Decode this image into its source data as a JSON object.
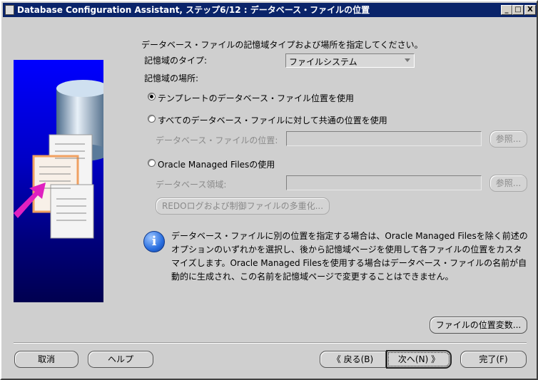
{
  "window": {
    "title": "Database Configuration Assistant, ステップ6/12 : データベース・ファイルの位置",
    "minimize": "_",
    "maximize": "□",
    "close": "X"
  },
  "instruction": "データベース・ファイルの記憶域タイプおよび場所を指定してください。",
  "storage_type": {
    "label": "記憶域のタイプ:",
    "value": "ファイルシステム"
  },
  "storage_location": {
    "label": "記憶域の場所:"
  },
  "options": [
    {
      "label": "テンプレートのデータベース・ファイル位置を使用",
      "selected": true
    },
    {
      "label": "すべてのデータベース・ファイルに対して共通の位置を使用",
      "selected": false
    },
    {
      "label": "Oracle Managed Filesの使用",
      "selected": false
    }
  ],
  "db_file_location": {
    "label": "データベース・ファイルの位置:",
    "value": "",
    "browse": "参照..."
  },
  "db_area": {
    "label": "データベース領域:",
    "value": "",
    "browse": "参照..."
  },
  "multiplex_button": "REDOログおよび制御ファイルの多重化...",
  "info_text": "データベース・ファイルに別の位置を指定する場合は、Oracle Managed Filesを除く前述のオプションのいずれかを選択し、後から記憶域ページを使用して各ファイルの位置をカスタマイズします。Oracle Managed Filesを使用する場合はデータベース・ファイルの名前が自動的に生成され、この名前を記憶域ページで変更することはできません。",
  "file_location_vars_button": "ファイルの位置変数...",
  "footer": {
    "cancel": "取消",
    "help": "ヘルプ",
    "back": "《  戻る(B)",
    "next": "次へ(N)  》",
    "finish": "完了(F)"
  }
}
